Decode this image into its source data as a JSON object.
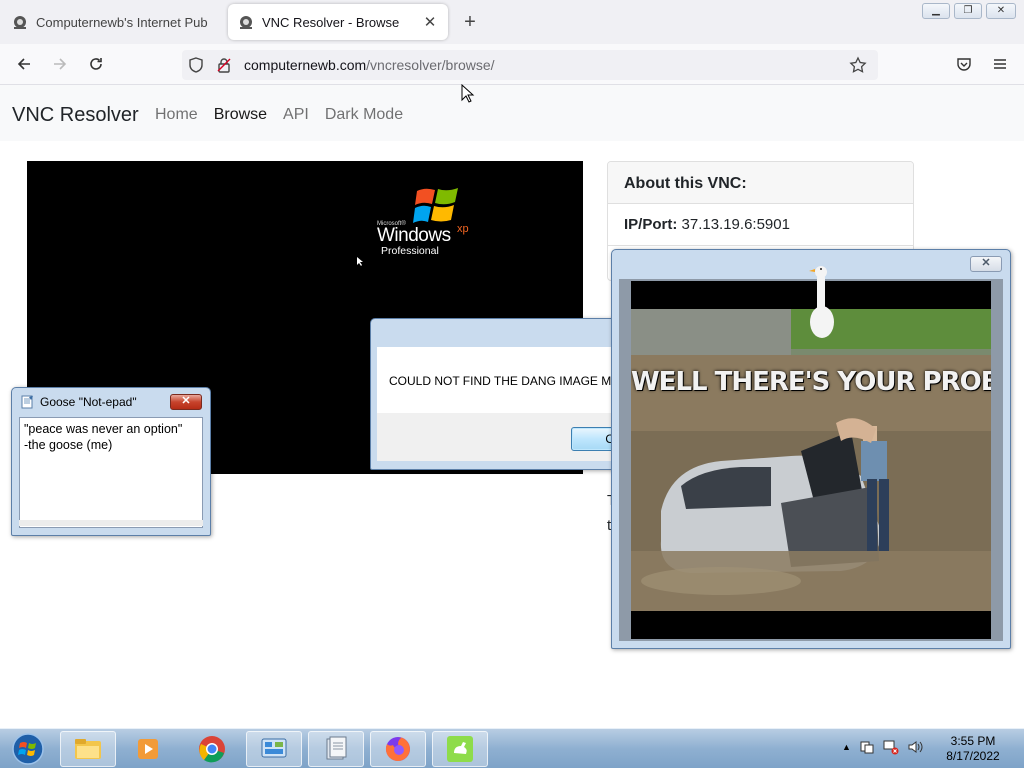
{
  "browser": {
    "tabs": [
      {
        "title": "Computernewb's Internet Pub",
        "active": false
      },
      {
        "title": "VNC Resolver - Browse",
        "active": true
      }
    ],
    "new_tab_icon": "plus-icon",
    "url_domain": "computernewb.com",
    "url_path": "/vncresolver/browse/"
  },
  "site": {
    "brand": "VNC Resolver",
    "nav": [
      "Home",
      "Browse",
      "API",
      "Dark Mode"
    ]
  },
  "vnc_screen": {
    "logo_small": "Microsoft®",
    "logo_main": "Windows",
    "logo_sup": "xp",
    "logo_edition": "Professional"
  },
  "about": {
    "title": "About this VNC:",
    "ip_label": "IP/Port:",
    "ip_value": "37.13.19.6:5901",
    "peek1": "T",
    "peek2": "t"
  },
  "goose_note": {
    "title": "Goose \"Not-epad\"",
    "text": "\"peace was never an option\"\n   -the goose (me)"
  },
  "alert": {
    "message": "COULD NOT FIND THE DANG IMAGE MEME",
    "ok_label": "OK"
  },
  "meme": {
    "caption": "WELL THERE'S YOUR PROBLEM"
  },
  "taskbar": {
    "time": "3:55 PM",
    "date": "8/17/2022"
  },
  "colors": {
    "accent": "#3c7fb1",
    "close_red": "#c7432c",
    "taskbar": "#8fb0d1"
  }
}
